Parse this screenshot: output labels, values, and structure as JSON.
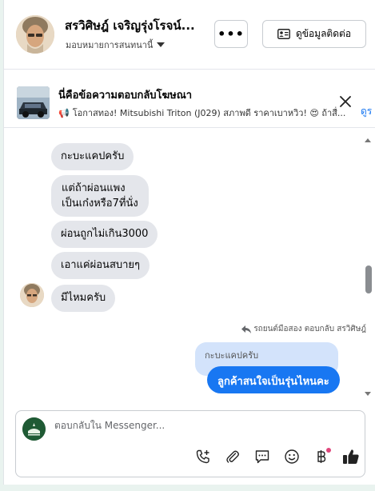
{
  "header": {
    "contact_name": "สรวิศิษฎ์ เจริญรุ่งโรจน์...",
    "assign_label": "มอบหมายการสนทนานี้",
    "more_label": "•••",
    "contact_info_label": "ดูข้อมูลติดต่อ"
  },
  "ad_banner": {
    "title": "นี่คือข้อความตอบกลับโฆษณา",
    "text": "โอกาสทอง! Mitsubishi Triton (J029) สภาพดี ราคาเบาหวิว! 😍 ถ้าสื่...",
    "see_link": "ดูร"
  },
  "messages": {
    "incoming": [
      "กะบะแคปครับ",
      "แต่ถ้าผ่อนแพง",
      "เป็นเก๋งหรือ7ที่นั่ง",
      "ผ่อนถูกไม่เกิน3000",
      "เอาแค่ผ่อนสบายๆ",
      "มีไหมครับ"
    ],
    "reply_note": "รถยนต์มือสอง ตอบกลับ สรวิศิษฎ์",
    "quoted": "กะบะแคปครับ",
    "sent": "ลูกค้าสนใจเป็นรุ่นไหนคะ"
  },
  "composer": {
    "placeholder": "ตอบกลับใน Messenger..."
  },
  "icons": {
    "call": "call-add-icon",
    "attach": "paperclip-icon",
    "saved_replies": "chat-bubble-icon",
    "emoji": "smile-icon",
    "payment": "baht-icon",
    "like": "thumbs-up-icon"
  },
  "colors": {
    "accent": "#1877f2",
    "bubble_in": "#e4e6eb",
    "quoted_bg": "#d3e3fb",
    "notification_dot": "#e0457b"
  }
}
